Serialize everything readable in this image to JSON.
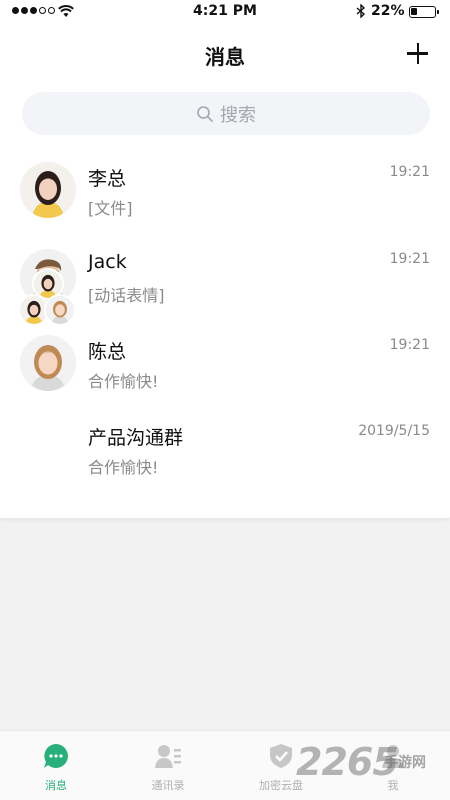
{
  "status_bar": {
    "time": "4:21 PM",
    "battery_percent": "22%",
    "battery_level": 0.22,
    "signal_bars_filled": 3,
    "signal_bars_total": 5
  },
  "header": {
    "title": "消息",
    "add_icon": "plus-icon"
  },
  "search": {
    "placeholder": "搜索",
    "icon": "search-icon"
  },
  "conversations": [
    {
      "name": "李总",
      "preview": "[文件]",
      "time": "19:21"
    },
    {
      "name": "Jack",
      "preview": "[动话表情]",
      "time": "19:21"
    },
    {
      "name": "陈总",
      "preview": "合作愉快!",
      "time": "19:21"
    },
    {
      "name": "产品沟通群",
      "preview": "合作愉快!",
      "time": "2019/5/15"
    }
  ],
  "tabbar": {
    "items": [
      {
        "label": "消息",
        "icon": "chat-bubble-icon",
        "active": true
      },
      {
        "label": "通讯录",
        "icon": "contacts-icon",
        "active": false
      },
      {
        "label": "加密云盘",
        "icon": "shield-check-icon",
        "active": false
      },
      {
        "label": "我",
        "icon": "person-icon",
        "active": false
      }
    ]
  },
  "watermark": {
    "main": "2265",
    "sub": "手游网"
  },
  "colors": {
    "accent": "#27b07a",
    "background": "#f2f2f2",
    "search_bg": "#f3f4f7",
    "muted_text": "#8a8a8a"
  }
}
